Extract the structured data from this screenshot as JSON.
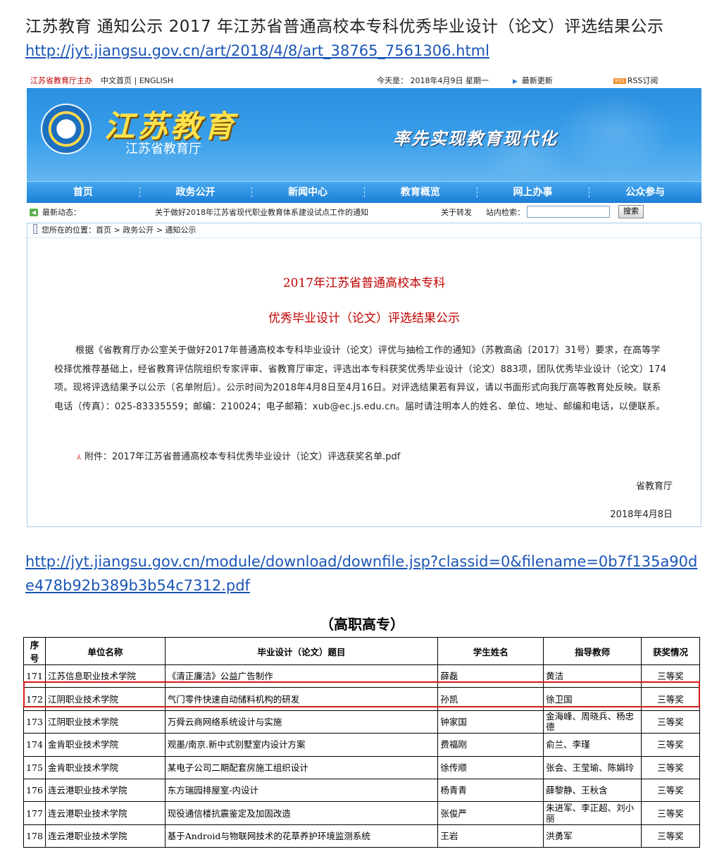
{
  "doc_title": "江苏教育  通知公示  2017  年江苏省普通高校本专科优秀毕业设计（论文）评选结果公示",
  "link1": "http://jyt.jiangsu.gov.cn/art/2018/4/8/art_38765_7561306.html",
  "link2": "http://jyt.jiangsu.gov.cn/module/download/downfile.jsp?classid=0&filename=0b7f135a90de478b92b389b3b54c7312.pdf",
  "site": {
    "topbar": {
      "host": "江苏省教育厅主办",
      "links": "中文首页 | ENGLISH",
      "date": "今天是： 2018年4月9日  星期一",
      "latest": "最新更新",
      "rss_box": "RSS",
      "rss": "RSS订阅"
    },
    "banner": {
      "title": "江苏教育",
      "subtitle": "江苏省教育厅",
      "slogan": "率先实现教育现代化"
    },
    "nav": [
      "首页",
      "政务公开",
      "新闻中心",
      "教育概览",
      "网上办事",
      "公众参与"
    ],
    "ticker": {
      "label": "最新动态：",
      "news": "关于做好2018年江苏省现代职业教育体系建设试点工作的通知",
      "news2": "关于转发",
      "search_label": "站内检索：",
      "search_button": "搜索"
    },
    "breadcrumb": "您所在的位置：首页 > 政务公开 > 通知公示",
    "article": {
      "title1": "2017年江苏省普通高校本专科",
      "title2": "优秀毕业设计（论文）评选结果公示",
      "body": "根据《省教育厅办公室关于做好2017年普通高校本专科毕业设计（论文）评优与抽检工作的通知》（苏教高函〔2017〕31号）要求，在高等学校择优推荐基础上，经省教育评估院组织专家评审、省教育厅审定，评选出本专科获奖优秀毕业设计（论文）883项，团队优秀毕业设计（论文）174项。现将评选结果予以公示（名单附后）。公示时间为2018年4月8日至4月16日。对评选结果若有异议，请以书面形式向我厅高等教育处反映。联系电话（传真）：025-83335559；邮编：210024；电子邮箱：xub@ec.js.edu.cn。届时请注明本人的姓名、单位、地址、邮编和电话，以便联系。",
      "attachment": "附件：2017年江苏省普通高校本专科优秀毕业设计（论文）评选获奖名单.pdf",
      "signer": "省教育厅",
      "date": "2018年4月8日"
    }
  },
  "table": {
    "caption": "（高职高专）",
    "headers": [
      "序号",
      "单位名称",
      "毕业设计（论文）题目",
      "学生姓名",
      "指导教师",
      "获奖情况"
    ],
    "rows": [
      [
        "171",
        "江苏信息职业技术学院",
        "《清正廉洁》公益广告制作",
        "薛磊",
        "黄洁",
        "三等奖"
      ],
      [
        "172",
        "江阴职业技术学院",
        "气门零件快速自动储料机构的研发",
        "孙凯",
        "徐卫国",
        "三等奖"
      ],
      [
        "173",
        "江阴职业技术学院",
        "万舜云商网络系统设计与实施",
        "钟家国",
        "金海峰、周晓兵、杨忠德",
        "三等奖"
      ],
      [
        "174",
        "金肯职业技术学院",
        "观墨/南京.新中式别墅室内设计方案",
        "费福刚",
        "俞兰、李瑾",
        "三等奖"
      ],
      [
        "175",
        "金肯职业技术学院",
        "某电子公司二期配套房施工组织设计",
        "徐传顺",
        "张会、王莹瑜、陈娟玲",
        "三等奖"
      ],
      [
        "176",
        "连云港职业技术学院",
        "东方瑞园排屋室-内设计",
        "杨青青",
        "薛黎静、王秋含",
        "三等奖"
      ],
      [
        "177",
        "连云港职业技术学院",
        "现役通信楼抗震鉴定及加固改造",
        "张俊严",
        "朱进军、李正超、刘小丽",
        "三等奖"
      ],
      [
        "178",
        "连云港职业技术学院",
        "基于Android与物联网技术的花草养护环境监测系统",
        "王岩",
        "洪勇军",
        "三等奖"
      ]
    ]
  },
  "colors": {
    "highlight": "#d81919",
    "link": "#1a55b5",
    "title_red": "#c00000",
    "banner_blue": "#2a8fe0"
  }
}
